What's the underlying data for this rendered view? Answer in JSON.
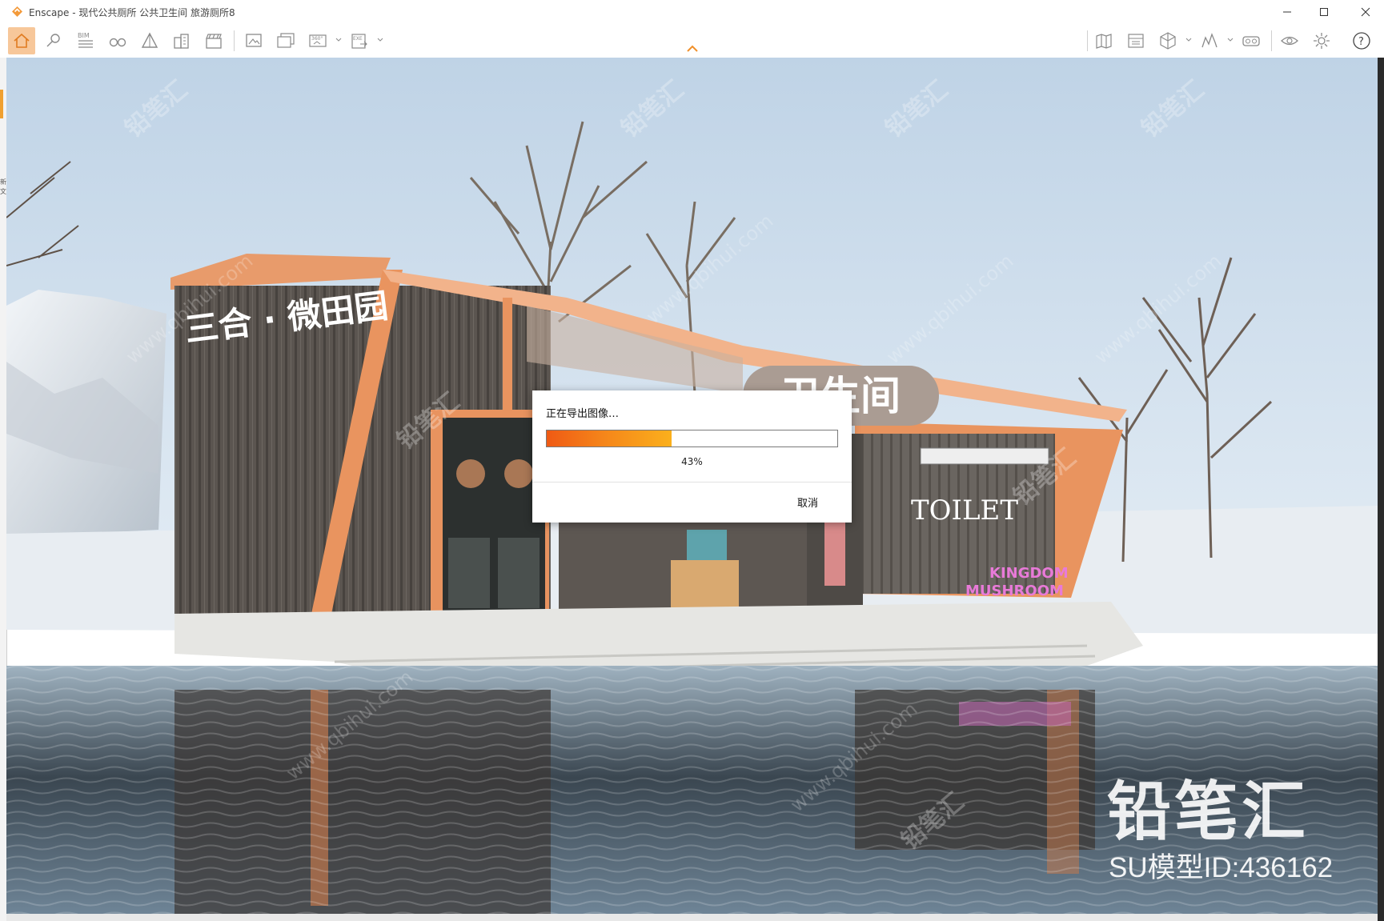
{
  "window": {
    "title": "Enscape - 现代公共厕所 公共卫生间 旅游厕所8",
    "accent": "#f5a65b"
  },
  "toolbar": {
    "left_icons": [
      "home-icon",
      "location-icon",
      "bim-icon",
      "binoculars-icon",
      "perspective-icon",
      "buildings-icon",
      "clapboard-icon",
      "screenshot-icon",
      "batch-render-icon",
      "panorama-360-icon",
      "exe-export-icon"
    ],
    "bim_label": "BIM",
    "pano_label": "360°",
    "exe_label": "EXE",
    "right_icons": [
      "map-icon",
      "asset-library-icon",
      "cube-icon",
      "chart-icon",
      "vr-headset-icon",
      "eye-icon",
      "settings-icon",
      "help-icon"
    ],
    "help_label": "?"
  },
  "scene": {
    "sign_left": "三合 · 微田园",
    "sign_center": "卫生间",
    "sign_toilet": "TOILET",
    "neon_line1": "KINGDOM",
    "neon_line2": "MUSHROOM"
  },
  "export_dialog": {
    "title": "正在导出图像…",
    "progress": 0.43,
    "progress_text": "43%",
    "cancel_label": "取消"
  },
  "watermark": {
    "brand": "铅笔汇",
    "model_id": "SU模型ID:436162",
    "diagonal": "铅笔汇",
    "url": "www.qbihui.com"
  },
  "left_strip_text": "新\n文"
}
